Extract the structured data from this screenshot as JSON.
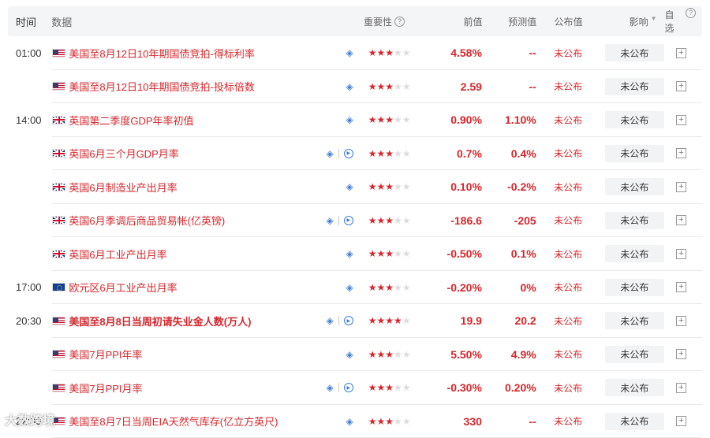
{
  "headers": {
    "time": "时间",
    "event": "数据",
    "importance": "重要性",
    "previous": "前值",
    "forecast": "预测值",
    "published": "公布值",
    "impact": "影响",
    "watchlist": "自选"
  },
  "rows": [
    {
      "time": "01:00",
      "flag": "us",
      "event": "美国至8月12日10年期国债竞拍-得标利率",
      "icons": "layers",
      "stars": 3,
      "previous": "4.58%",
      "forecast": "--",
      "published": "未公布",
      "impact": "未公布",
      "bold": false
    },
    {
      "time": "",
      "flag": "us",
      "event": "美国至8月12日10年期国债竞拍-投标倍数",
      "icons": "layers",
      "stars": 3,
      "previous": "2.59",
      "forecast": "--",
      "published": "未公布",
      "impact": "未公布",
      "bold": false
    },
    {
      "time": "14:00",
      "flag": "uk",
      "event": "英国第二季度GDP年率初值",
      "icons": "layers",
      "stars": 3,
      "previous": "0.90%",
      "forecast": "1.10%",
      "published": "未公布",
      "impact": "未公布",
      "bold": false
    },
    {
      "time": "",
      "flag": "uk",
      "event": "英国6月三个月GDP月率",
      "icons": "layers-play",
      "stars": 3,
      "previous": "0.7%",
      "forecast": "0.4%",
      "published": "未公布",
      "impact": "未公布",
      "bold": false
    },
    {
      "time": "",
      "flag": "uk",
      "event": "英国6月制造业产出月率",
      "icons": "layers",
      "stars": 3,
      "previous": "0.10%",
      "forecast": "-0.2%",
      "published": "未公布",
      "impact": "未公布",
      "bold": false
    },
    {
      "time": "",
      "flag": "uk",
      "event": "英国6月季调后商品贸易帐(亿英镑)",
      "icons": "layers-play",
      "stars": 3,
      "previous": "-186.6",
      "forecast": "-205",
      "published": "未公布",
      "impact": "未公布",
      "bold": false
    },
    {
      "time": "",
      "flag": "uk",
      "event": "英国6月工业产出月率",
      "icons": "layers",
      "stars": 3,
      "previous": "-0.50%",
      "forecast": "0.1%",
      "published": "未公布",
      "impact": "未公布",
      "bold": false
    },
    {
      "time": "17:00",
      "flag": "eu",
      "event": "欧元区6月工业产出月率",
      "icons": "layers",
      "stars": 3,
      "previous": "-0.20%",
      "forecast": "0%",
      "published": "未公布",
      "impact": "未公布",
      "bold": false
    },
    {
      "time": "20:30",
      "flag": "us",
      "event": "美国至8月8日当周初请失业金人数(万人)",
      "icons": "layers-play",
      "stars": 4,
      "previous": "19.9",
      "forecast": "20.2",
      "published": "未公布",
      "impact": "未公布",
      "bold": true
    },
    {
      "time": "",
      "flag": "us",
      "event": "美国7月PPI年率",
      "icons": "layers",
      "stars": 3,
      "previous": "5.50%",
      "forecast": "4.9%",
      "published": "未公布",
      "impact": "未公布",
      "bold": false
    },
    {
      "time": "",
      "flag": "us",
      "event": "美国7月PPI月率",
      "icons": "layers-play",
      "stars": 3,
      "previous": "-0.30%",
      "forecast": "0.20%",
      "published": "未公布",
      "impact": "未公布",
      "bold": false
    },
    {
      "time": "22:30",
      "flag": "us",
      "event": "美国至8月7日当周EIA天然气库存(亿立方英尺)",
      "icons": "layers",
      "stars": 3,
      "previous": "330",
      "forecast": "--",
      "published": "未公布",
      "impact": "未公布",
      "bold": false
    }
  ],
  "watermark": "大数跨境",
  "colors": {
    "accent": "#d2282e",
    "icon": "#3e7bd6",
    "header_bg": "#f4f5f7"
  }
}
